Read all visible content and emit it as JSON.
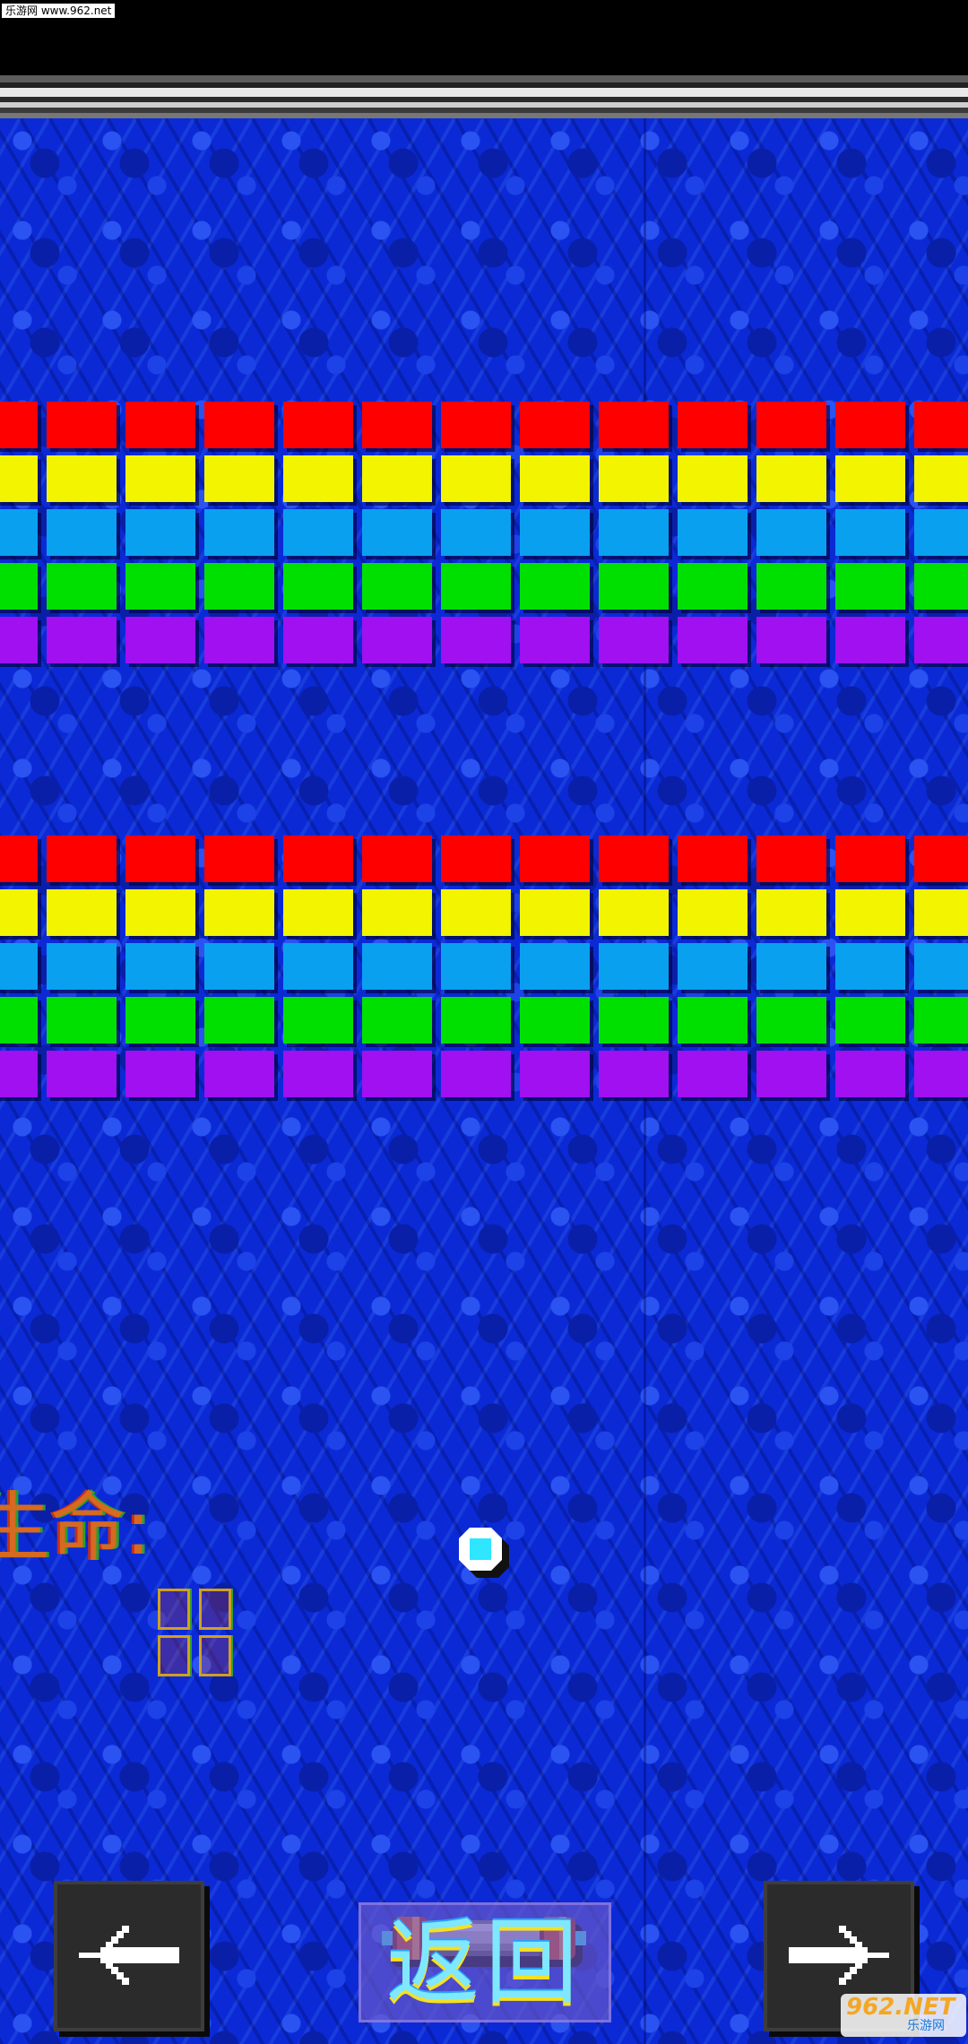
{
  "header": {
    "source_label": "乐游网 www.962.net"
  },
  "bricks": {
    "groups": [
      {
        "rows": [
          "red",
          "yellow",
          "cyan",
          "green",
          "purple"
        ]
      },
      {
        "rows": [
          "red",
          "yellow",
          "cyan",
          "green",
          "purple"
        ]
      }
    ],
    "columns_per_row": 13,
    "colors": {
      "red": "#ff0000",
      "yellow": "#f2f400",
      "cyan": "#0aa0f0",
      "green": "#00e000",
      "purple": "#a010f0"
    }
  },
  "hud": {
    "lives_label": "生命:",
    "lives_count": 4
  },
  "ball": {
    "color": "#2ee6ff"
  },
  "controls": {
    "left_icon": "arrow-left-icon",
    "right_icon": "arrow-right-icon",
    "return_label": "返回"
  },
  "watermark": {
    "brand": "962.NET",
    "sub": "乐游网"
  }
}
